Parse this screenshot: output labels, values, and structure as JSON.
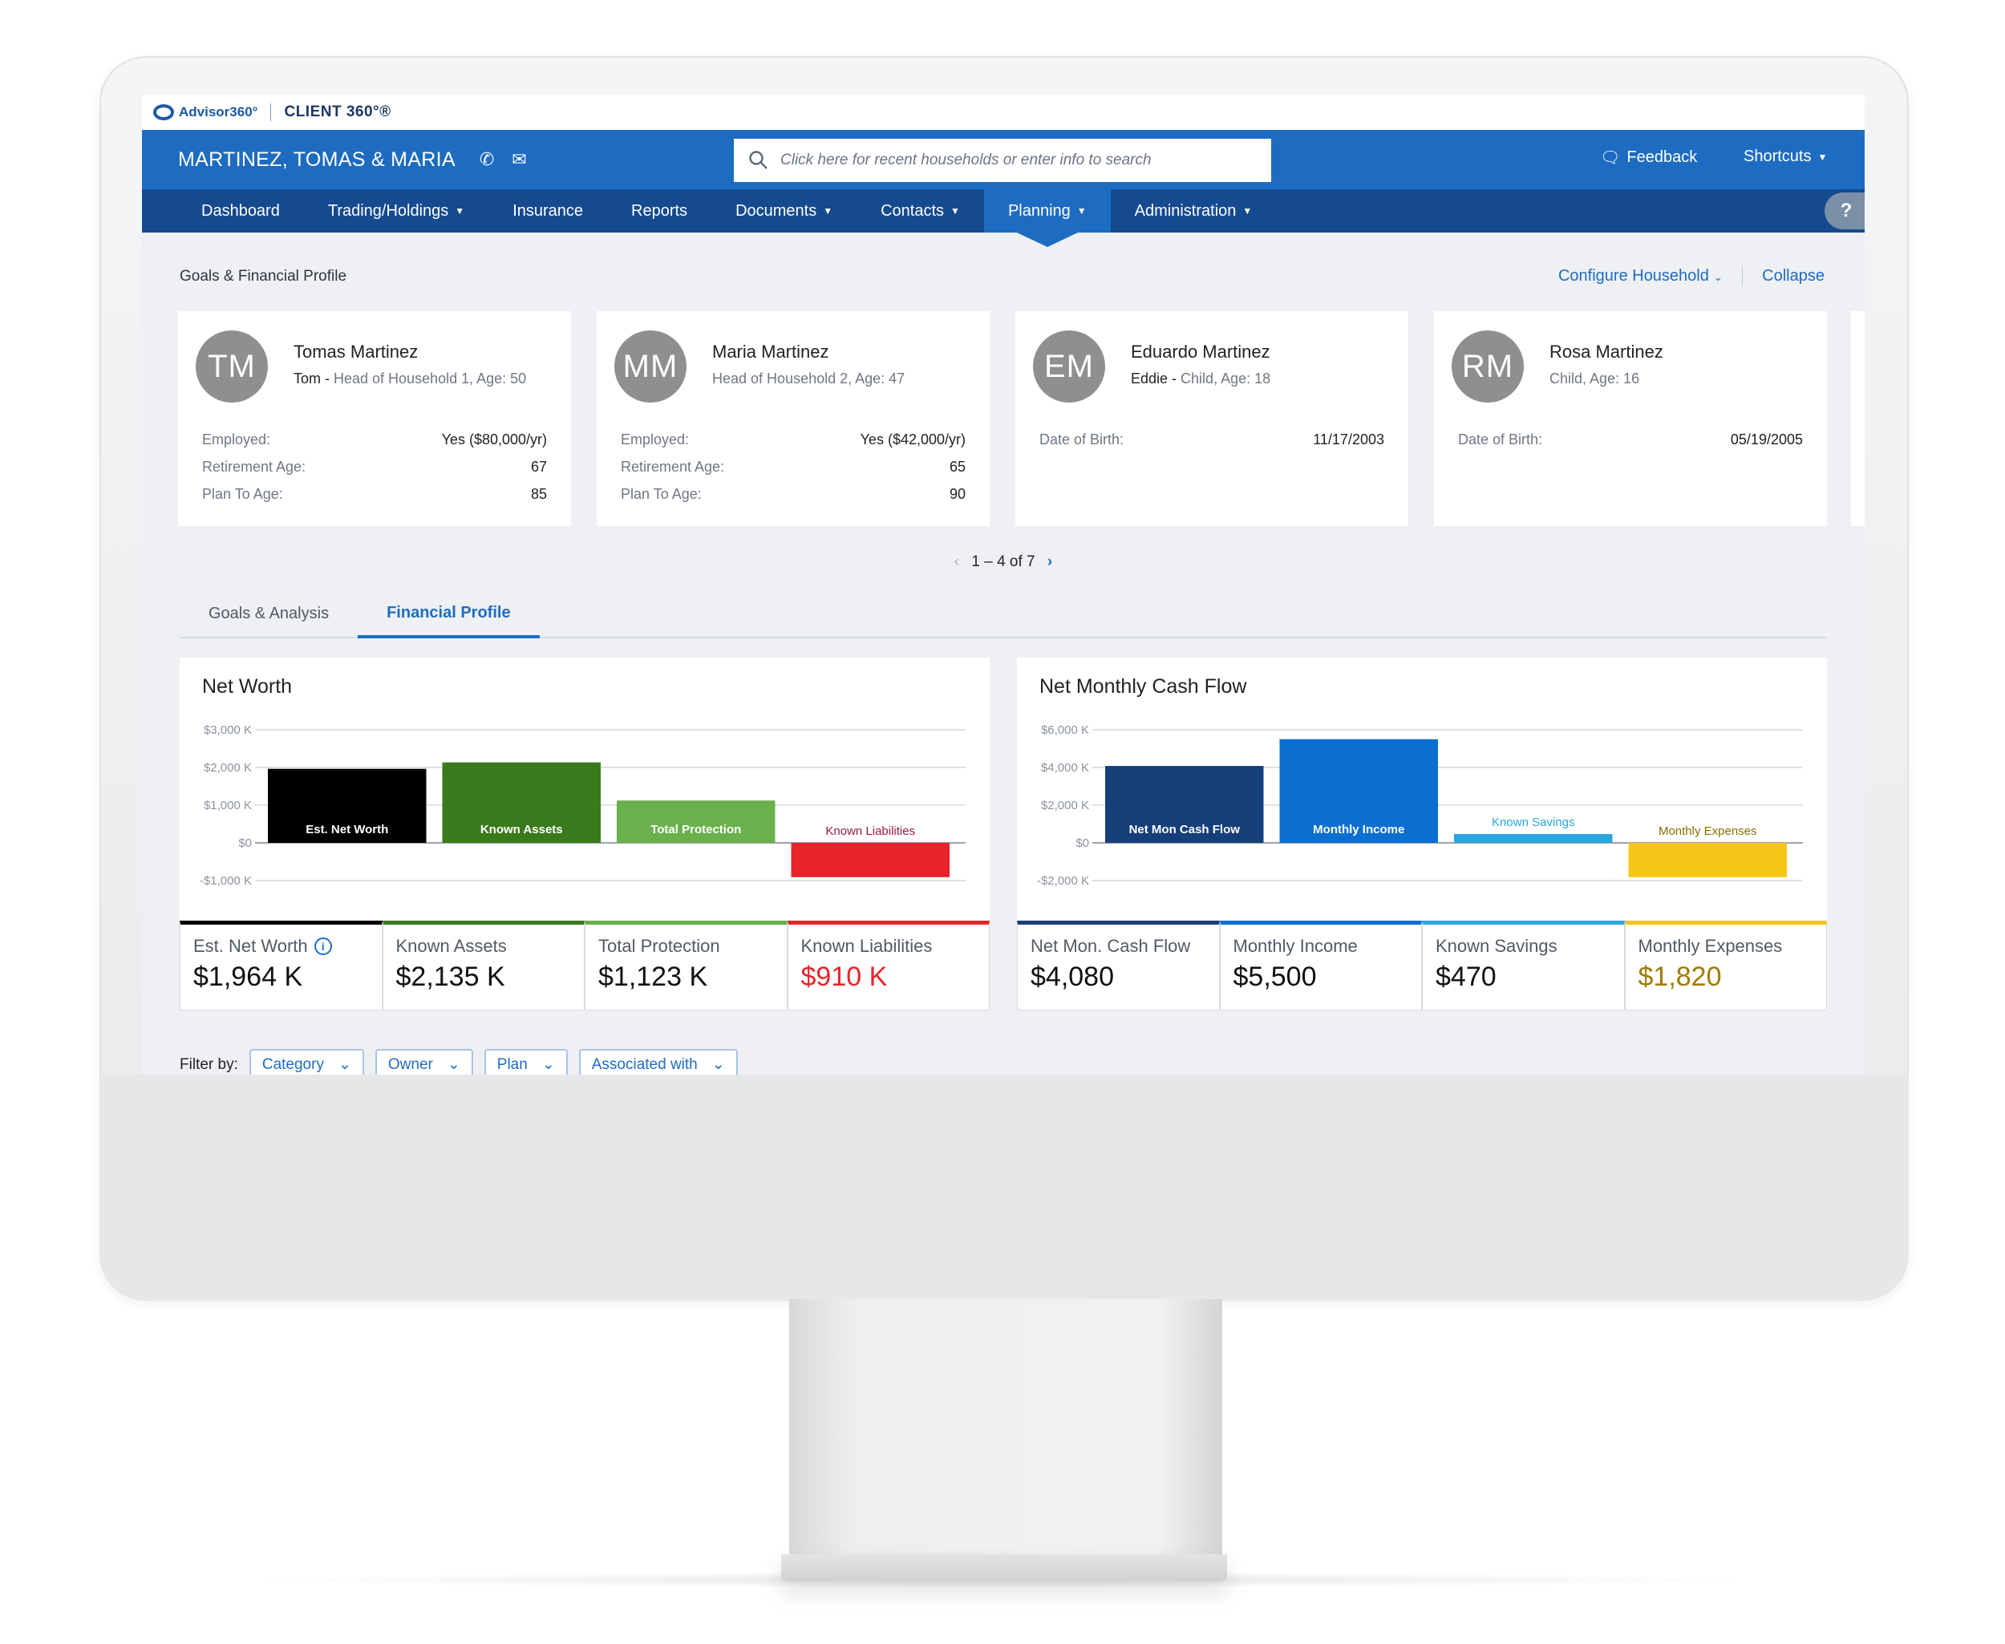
{
  "brand": {
    "advisor": "Advisor360°",
    "client": "CLIENT 360°®"
  },
  "header": {
    "household": "MARTINEZ, TOMAS & MARIA",
    "search_placeholder": "Click here for recent households or enter info to search",
    "feedback": "Feedback",
    "shortcuts": "Shortcuts"
  },
  "nav": {
    "items": [
      {
        "label": "Dashboard"
      },
      {
        "label": "Trading/Holdings"
      },
      {
        "label": "Insurance"
      },
      {
        "label": "Reports"
      },
      {
        "label": "Documents"
      },
      {
        "label": "Contacts"
      },
      {
        "label": "Planning"
      },
      {
        "label": "Administration"
      }
    ],
    "active": "Planning",
    "help": "?"
  },
  "page": {
    "section_title": "Goals & Financial Profile",
    "configure": "Configure Household",
    "collapse": "Collapse"
  },
  "members": [
    {
      "initials": "TM",
      "name": "Tomas Martinez",
      "nick": "Tom -",
      "role": " Head of Household 1, Age: 50",
      "fields": [
        {
          "k": "Employed:",
          "v": "Yes ($80,000/yr)"
        },
        {
          "k": "Retirement Age:",
          "v": "67"
        },
        {
          "k": "Plan To Age:",
          "v": "85"
        }
      ]
    },
    {
      "initials": "MM",
      "name": "Maria Martinez",
      "nick": "",
      "role": "Head of Household 2, Age: 47",
      "fields": [
        {
          "k": "Employed:",
          "v": "Yes ($42,000/yr)"
        },
        {
          "k": "Retirement Age:",
          "v": "65"
        },
        {
          "k": "Plan To Age:",
          "v": "90"
        }
      ]
    },
    {
      "initials": "EM",
      "name": "Eduardo Martinez",
      "nick": "Eddie -",
      "role": " Child, Age: 18",
      "fields": [
        {
          "k": "Date of Birth:",
          "v": "11/17/2003"
        }
      ]
    },
    {
      "initials": "RM",
      "name": "Rosa Martinez",
      "nick": "",
      "role": "Child, Age: 16",
      "fields": [
        {
          "k": "Date of Birth:",
          "v": "05/19/2005"
        }
      ]
    }
  ],
  "pager": {
    "text": "1 – 4 of 7"
  },
  "tabs": [
    {
      "label": "Goals & Analysis"
    },
    {
      "label": "Financial Profile"
    }
  ],
  "active_tab": "Financial Profile",
  "chart_data": [
    {
      "type": "bar",
      "title": "Net Worth",
      "categories": [
        "Est. Net Worth",
        "Known Assets",
        "Total Protection",
        "Known Liabilities"
      ],
      "values": [
        1964,
        2135,
        1123,
        -910
      ],
      "colors": [
        "#000000",
        "#3a7a1c",
        "#6ab04c",
        "#e8232b"
      ],
      "label_colors": [
        "#ffffff",
        "#ffffff",
        "#ffffff",
        "#9c1a3a"
      ],
      "y_ticks": [
        {
          "v": 3000,
          "t": "$3,000 K"
        },
        {
          "v": 2000,
          "t": "$2,000 K"
        },
        {
          "v": 1000,
          "t": "$1,000 K"
        },
        {
          "v": 0,
          "t": "$0"
        },
        {
          "v": -1000,
          "t": "-$1,000 K"
        }
      ],
      "ylim": [
        -1000,
        3000
      ],
      "summary": [
        {
          "label": "Est. Net Worth",
          "value": "$1,964 K",
          "color": "#000000",
          "value_color": "#111111",
          "info": true
        },
        {
          "label": "Known Assets",
          "value": "$2,135 K",
          "color": "#3a7a1c",
          "value_color": "#111111"
        },
        {
          "label": "Total Protection",
          "value": "$1,123 K",
          "color": "#6ab04c",
          "value_color": "#111111"
        },
        {
          "label": "Known Liabilities",
          "value": "$910 K",
          "color": "#e8232b",
          "value_color": "#e8232b"
        }
      ]
    },
    {
      "type": "bar",
      "title": "Net Monthly Cash Flow",
      "categories": [
        "Net Mon Cash Flow",
        "Monthly Income",
        "Known Savings",
        "Monthly Expenses"
      ],
      "values": [
        4080,
        5500,
        470,
        -1820
      ],
      "colors": [
        "#163f7a",
        "#0a6fd0",
        "#2ba4e0",
        "#f5c518"
      ],
      "label_colors": [
        "#ffffff",
        "#ffffff",
        "#2ba4e0",
        "#8a6d00"
      ],
      "y_ticks": [
        {
          "v": 6000,
          "t": "$6,000 K"
        },
        {
          "v": 4000,
          "t": "$4,000 K"
        },
        {
          "v": 2000,
          "t": "$2,000 K"
        },
        {
          "v": 0,
          "t": "$0"
        },
        {
          "v": -2000,
          "t": "-$2,000 K"
        }
      ],
      "ylim": [
        -2000,
        6000
      ],
      "summary": [
        {
          "label": "Net Mon. Cash Flow",
          "value": "$4,080",
          "color": "#163f7a",
          "value_color": "#111111"
        },
        {
          "label": "Monthly Income",
          "value": "$5,500",
          "color": "#0a6fd0",
          "value_color": "#111111"
        },
        {
          "label": "Known Savings",
          "value": "$470",
          "color": "#2ba4e0",
          "value_color": "#111111"
        },
        {
          "label": "Monthly Expenses",
          "value": "$1,820",
          "color": "#f5c518",
          "value_color": "#a07c00"
        }
      ]
    }
  ],
  "filters": {
    "label": "Filter by:",
    "chips": [
      {
        "label": "Category"
      },
      {
        "label": "Owner"
      },
      {
        "label": "Plan"
      },
      {
        "label": "Associated with"
      }
    ]
  }
}
